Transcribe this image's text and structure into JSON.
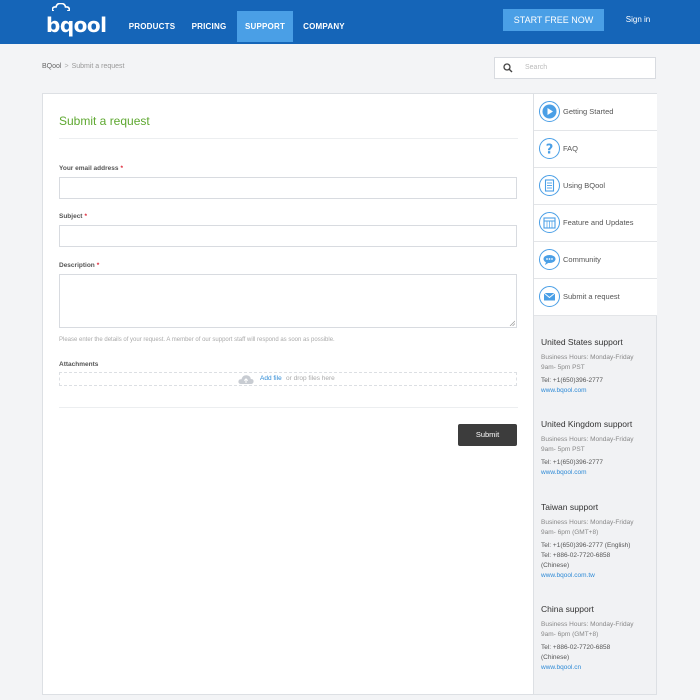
{
  "header": {
    "logo": "bqool",
    "nav": [
      "PRODUCTS",
      "PRICING",
      "SUPPORT",
      "COMPANY"
    ],
    "active_nav": "SUPPORT",
    "cta": "START FREE NOW",
    "signin": "Sign in",
    "brand_color": "#1565b8",
    "accent_color": "#4a9fe6"
  },
  "breadcrumb": {
    "home": "BQool",
    "separator": ">",
    "current": "Submit a request"
  },
  "search": {
    "placeholder": "Search",
    "icon": "search-icon"
  },
  "form": {
    "title": "Submit a request",
    "email_label": "Your email address",
    "subject_label": "Subject",
    "description_label": "Description",
    "required_mark": "*",
    "hint": "Please enter the details of your request. A member of our support staff will respond as soon as possible.",
    "attachments_label": "Attachments",
    "add_file": "Add file",
    "drop_text": "or drop files here",
    "submit": "Submit"
  },
  "sidebar": {
    "items": [
      {
        "label": "Getting Started",
        "icon": "play-icon"
      },
      {
        "label": "FAQ",
        "icon": "question-icon"
      },
      {
        "label": "Using BQool",
        "icon": "document-icon"
      },
      {
        "label": "Feature and Updates",
        "icon": "calendar-icon"
      },
      {
        "label": "Community",
        "icon": "chat-bubble-icon"
      },
      {
        "label": "Submit a request",
        "icon": "mail-icon"
      }
    ],
    "support": [
      {
        "title": "United States support",
        "hours1": "Business Hours: Monday-Friday",
        "hours2": "9am- 5pm PST",
        "tel": [
          "Tel: +1(650)396-2777"
        ],
        "link": "www.bqool.com"
      },
      {
        "title": "United Kingdom support",
        "hours1": "Business Hours: Monday-Friday",
        "hours2": "9am- 5pm PST",
        "tel": [
          "Tel: +1(650)396-2777"
        ],
        "link": "www.bqool.com"
      },
      {
        "title": "Taiwan support",
        "hours1": "Business Hours: Monday-Friday",
        "hours2": "9am- 6pm (GMT+8)",
        "tel": [
          "Tel: +1(650)396-2777 (English)",
          "Tel: +886-02-7720-6858",
          "(Chinese)"
        ],
        "link": "www.bqool.com.tw"
      },
      {
        "title": "China support",
        "hours1": "Business Hours: Monday-Friday",
        "hours2": "9am- 6pm (GMT+8)",
        "tel": [
          "Tel: +886-02-7720-6858",
          "(Chinese)"
        ],
        "link": "www.bqool.cn"
      }
    ]
  }
}
